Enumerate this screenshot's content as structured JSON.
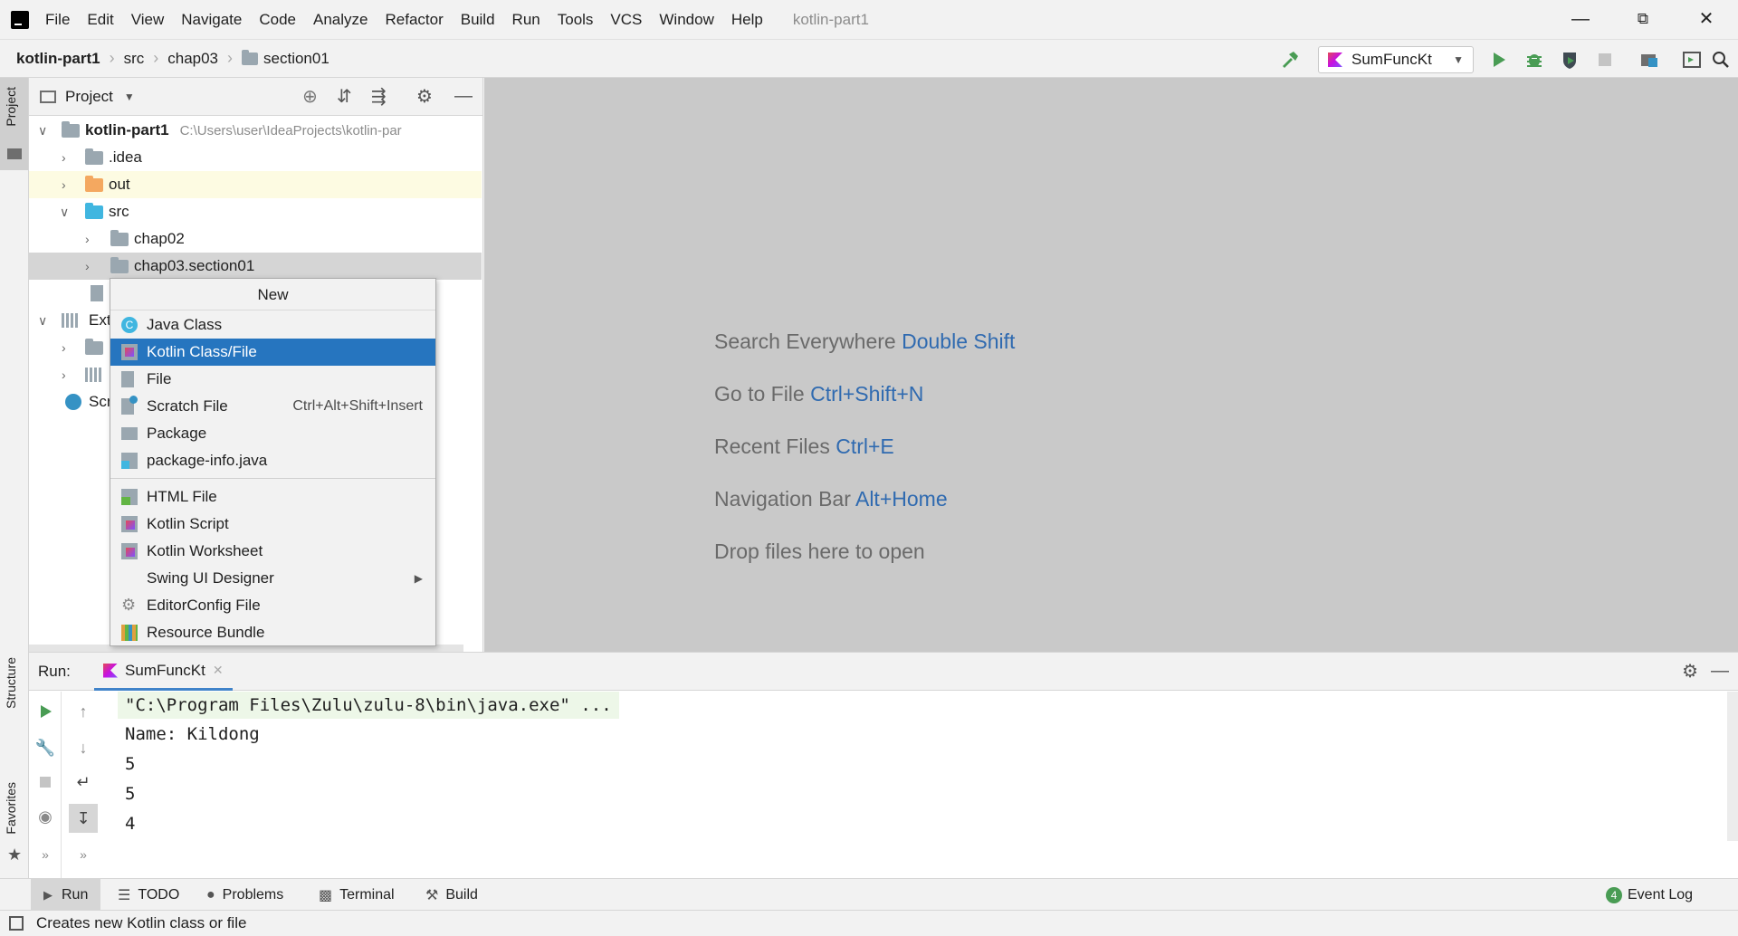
{
  "menubar": {
    "items": [
      "File",
      "Edit",
      "View",
      "Navigate",
      "Code",
      "Analyze",
      "Refactor",
      "Build",
      "Run",
      "Tools",
      "VCS",
      "Window",
      "Help"
    ],
    "window_title": "kotlin-part1"
  },
  "navbar": {
    "crumbs": [
      "kotlin-part1",
      "src",
      "chap03",
      "section01"
    ],
    "run_config": "SumFuncKt"
  },
  "left_strip": {
    "project_tab": "Project",
    "structure_tab": "Structure",
    "favorites_tab": "Favorites"
  },
  "project_panel": {
    "title": "Project",
    "tree": [
      {
        "label": "kotlin-part1",
        "path": "C:\\Users\\user\\IdeaProjects\\kotlin-par"
      },
      {
        "label": ".idea"
      },
      {
        "label": "out"
      },
      {
        "label": "src"
      },
      {
        "label": "chap02"
      },
      {
        "label": "chap03.section01"
      },
      {
        "label": "Ext"
      },
      {
        "label": "Scr"
      }
    ]
  },
  "context_menu": {
    "title": "New",
    "items": [
      {
        "label": "Java Class",
        "icon": "java-class-icon"
      },
      {
        "label": "Kotlin Class/File",
        "icon": "kotlin-file-icon",
        "selected": true
      },
      {
        "label": "File",
        "icon": "file-icon"
      },
      {
        "label": "Scratch File",
        "icon": "scratch-file-icon",
        "shortcut": "Ctrl+Alt+Shift+Insert"
      },
      {
        "label": "Package",
        "icon": "package-icon"
      },
      {
        "label": "package-info.java",
        "icon": "package-info-icon"
      },
      {
        "label": "HTML File",
        "icon": "html-file-icon"
      },
      {
        "label": "Kotlin Script",
        "icon": "kotlin-script-icon"
      },
      {
        "label": "Kotlin Worksheet",
        "icon": "kotlin-worksheet-icon"
      },
      {
        "label": "Swing UI Designer",
        "icon": "",
        "submenu": true
      },
      {
        "label": "EditorConfig File",
        "icon": "gear-icon"
      },
      {
        "label": "Resource Bundle",
        "icon": "resource-bundle-icon"
      }
    ]
  },
  "editor_hints": [
    {
      "text": "Search Everywhere ",
      "key": "Double Shift"
    },
    {
      "text": "Go to File ",
      "key": "Ctrl+Shift+N"
    },
    {
      "text": "Recent Files ",
      "key": "Ctrl+E"
    },
    {
      "text": "Navigation Bar ",
      "key": "Alt+Home"
    },
    {
      "text": "Drop files here to open",
      "key": ""
    }
  ],
  "run_panel": {
    "label": "Run:",
    "tab": "SumFuncKt",
    "console": [
      "\"C:\\Program Files\\Zulu\\zulu-8\\bin\\java.exe\" ...",
      "Name: Kildong",
      "5",
      "5",
      "4"
    ]
  },
  "bottom_tabs": [
    "Run",
    "TODO",
    "Problems",
    "Terminal",
    "Build"
  ],
  "event_log": {
    "label": "Event Log",
    "count": "4"
  },
  "status": "Creates new Kotlin class or file",
  "colors": {
    "selection": "#2675bf",
    "key_link": "#2f6ab0",
    "run_green": "#499c54"
  }
}
